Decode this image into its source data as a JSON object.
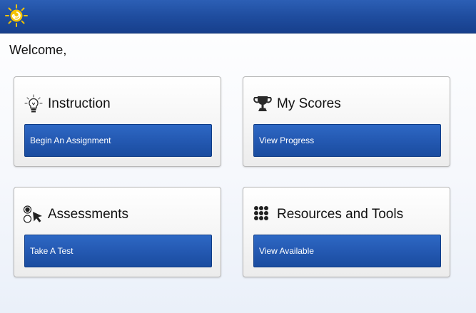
{
  "header": {
    "logo_icon": "sun-swirl-logo-icon",
    "background_color": "#1f4d9f"
  },
  "welcome": {
    "greeting": "Welcome,"
  },
  "cards": {
    "instruction": {
      "title": "Instruction",
      "icon": "lightbulb-icon",
      "button_label": "Begin An Assignment"
    },
    "scores": {
      "title": "My Scores",
      "icon": "trophy-icon",
      "button_label": "View Progress"
    },
    "assessments": {
      "title": "Assessments",
      "icon": "radio-cursor-icon",
      "button_label": "Take A Test"
    },
    "resources": {
      "title": "Resources and Tools",
      "icon": "dot-grid-icon",
      "button_label": "View Available"
    }
  },
  "colors": {
    "button_blue": "#2459b2",
    "header_blue": "#1f4d9f"
  }
}
